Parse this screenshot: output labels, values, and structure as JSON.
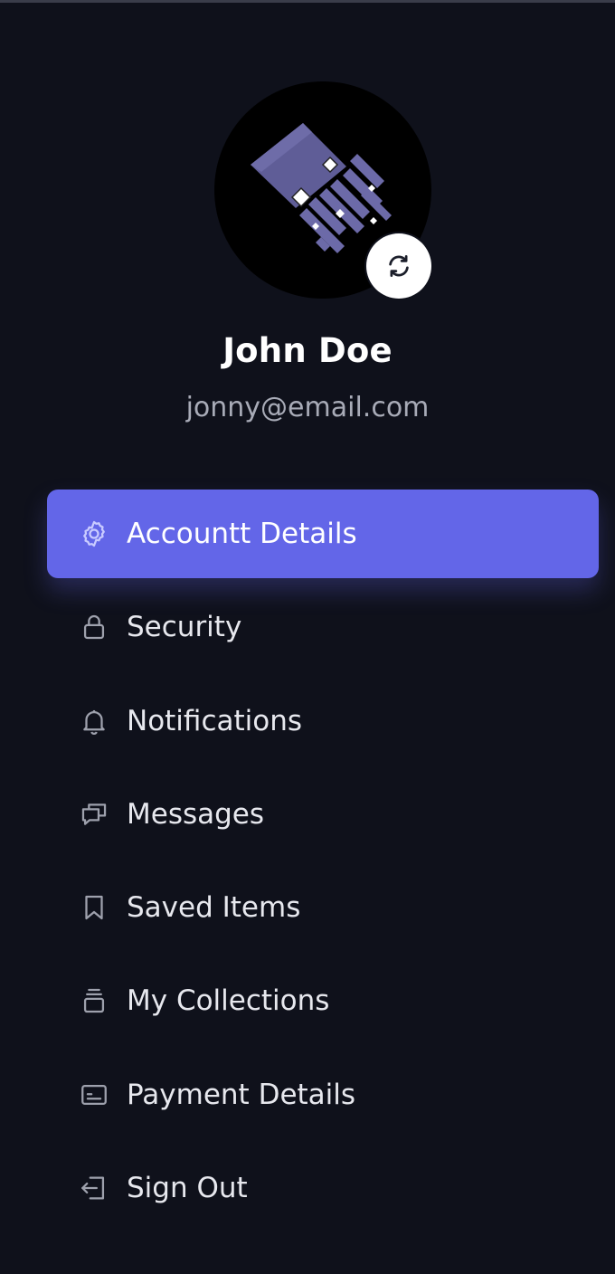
{
  "profile": {
    "name": "John Doe",
    "email": "jonny@email.com",
    "avatar_icon": "avatar-logo-icon",
    "swap_icon": "refresh-icon"
  },
  "menu": {
    "items": [
      {
        "label": "Accountt Details",
        "icon": "gear-icon",
        "active": true
      },
      {
        "label": "Security",
        "icon": "lock-icon",
        "active": false
      },
      {
        "label": "Notifications",
        "icon": "bell-icon",
        "active": false
      },
      {
        "label": "Messages",
        "icon": "chat-icon",
        "active": false
      },
      {
        "label": "Saved Items",
        "icon": "bookmark-icon",
        "active": false
      },
      {
        "label": "My Collections",
        "icon": "collection-stack-icon",
        "active": false
      },
      {
        "label": "Payment Details",
        "icon": "credit-card-icon",
        "active": false
      },
      {
        "label": "Sign Out",
        "icon": "sign-out-icon",
        "active": false
      }
    ]
  },
  "colors": {
    "background": "#0f111b",
    "accent": "#6366e8",
    "text": "#e7e8ee",
    "muted": "#a8abb7"
  }
}
